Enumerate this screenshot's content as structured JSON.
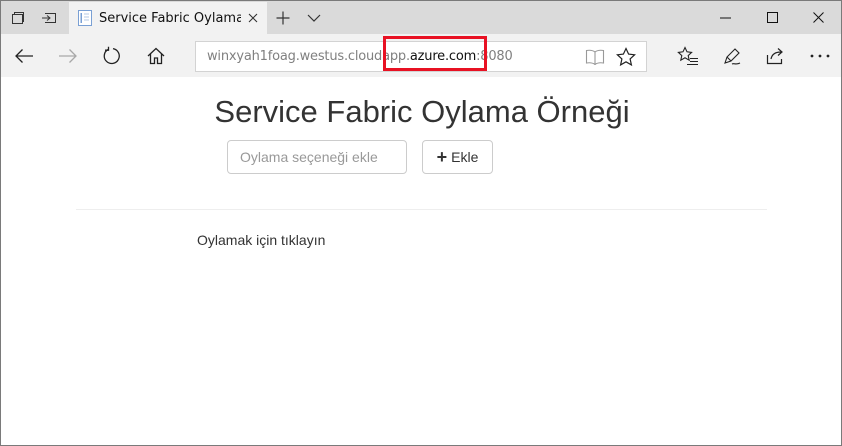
{
  "tab": {
    "title": "Service Fabric Oylama Ö"
  },
  "address_bar": {
    "url_prefix": "winxyah1foag.westus.cloudapp.",
    "url_host": "azure.com",
    "url_port": ":8080"
  },
  "page": {
    "title": "Service Fabric Oylama Örneği",
    "input_placeholder": "Oylama seçeneği ekle",
    "add_button_label": "Ekle",
    "vote_prompt": "Oylamak için tıklayın"
  },
  "colors": {
    "highlight": "#e81123",
    "tabstrip": "#dadada",
    "navbar": "#f2f2f2"
  },
  "icons": {
    "tabs_aside": "tab-manager-icon",
    "set_aside": "set-aside-icon",
    "new_tab": "plus-icon",
    "tab_list": "chevron-down-icon",
    "back": "back-arrow-icon",
    "forward": "forward-arrow-icon",
    "refresh": "refresh-icon",
    "home": "home-icon",
    "reading_view": "reading-view-icon",
    "favorite": "star-icon",
    "favorites_hub": "favorites-hub-icon",
    "notes": "pen-icon",
    "share": "share-icon",
    "more": "more-icon"
  }
}
